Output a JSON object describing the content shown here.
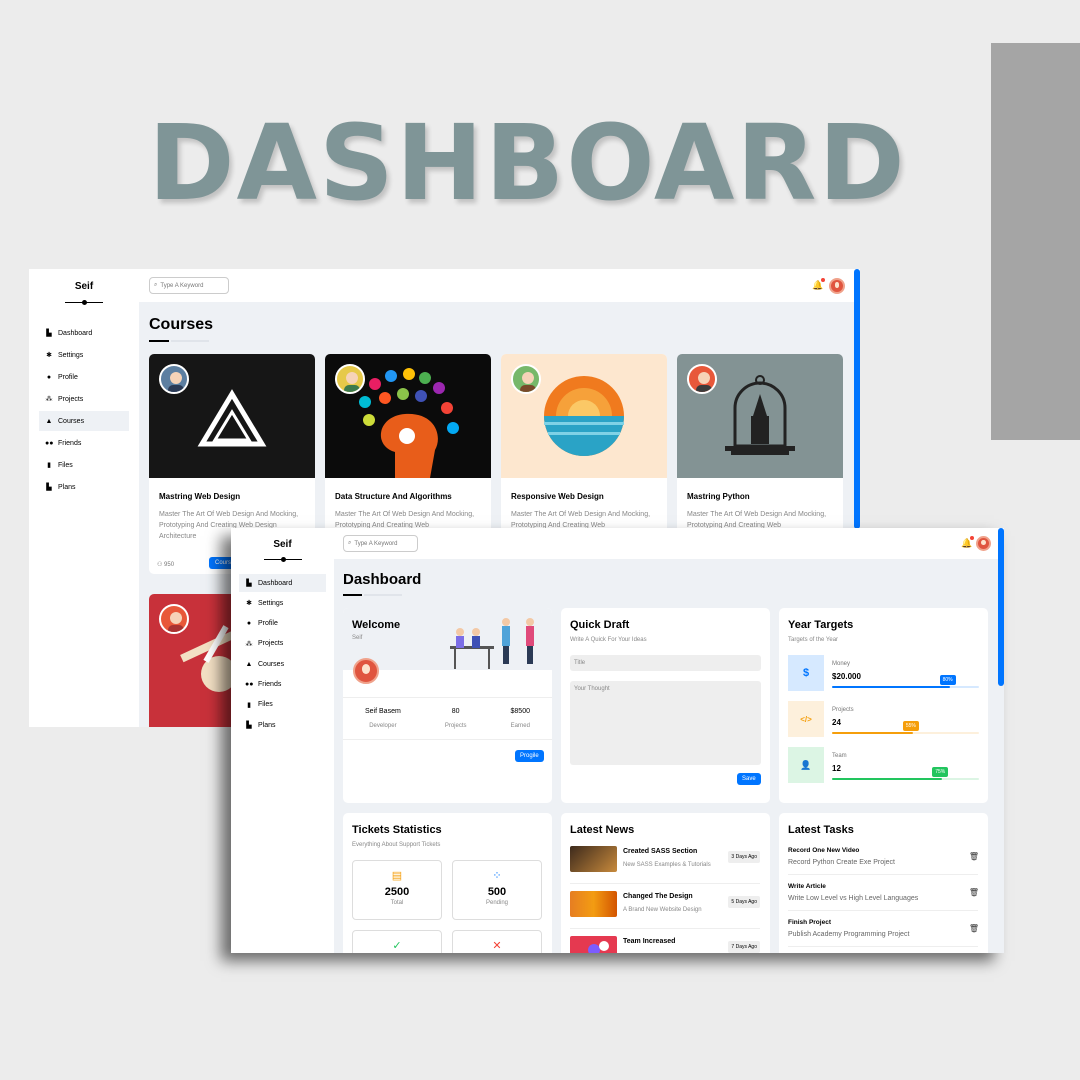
{
  "hero_title": "DASHBOARD",
  "back_window": {
    "brand": "Seif",
    "nav": [
      {
        "label": "Dashboard",
        "icon": "chart-icon"
      },
      {
        "label": "Settings",
        "icon": "gear-icon"
      },
      {
        "label": "Profile",
        "icon": "user-icon"
      },
      {
        "label": "Projects",
        "icon": "diagram-icon"
      },
      {
        "label": "Courses",
        "icon": "graduation-cap-icon"
      },
      {
        "label": "Friends",
        "icon": "users-icon"
      },
      {
        "label": "Files",
        "icon": "file-icon"
      },
      {
        "label": "Plans",
        "icon": "chart-icon"
      }
    ],
    "search_placeholder": "Type A Keyword",
    "page_title": "Courses",
    "courses": [
      {
        "title": "Mastring Web Design",
        "desc": "Master The Art Of Web Design And Mocking, Prototyping And Creating Web Design Architecture",
        "students": "950",
        "button": "Course Info"
      },
      {
        "title": "Data Structure And Algorithms",
        "desc": "Master The Art Of Web Design And Mocking, Prototyping And Creating Web"
      },
      {
        "title": "Responsive Web Design",
        "desc": "Master The Art Of Web Design And Mocking, Prototyping And Creating Web"
      },
      {
        "title": "Mastring Python",
        "desc": "Master The Art Of Web Design And Mocking, Prototyping And Creating Web"
      }
    ]
  },
  "front_window": {
    "brand": "Seif",
    "nav": [
      {
        "label": "Dashboard",
        "icon": "chart-icon"
      },
      {
        "label": "Settings",
        "icon": "gear-icon"
      },
      {
        "label": "Profile",
        "icon": "user-icon"
      },
      {
        "label": "Projects",
        "icon": "diagram-icon"
      },
      {
        "label": "Courses",
        "icon": "graduation-cap-icon"
      },
      {
        "label": "Friends",
        "icon": "users-icon"
      },
      {
        "label": "Files",
        "icon": "file-icon"
      },
      {
        "label": "Plans",
        "icon": "chart-icon"
      }
    ],
    "search_placeholder": "Type A Keyword",
    "page_title": "Dashboard",
    "welcome": {
      "title": "Welcome",
      "subtitle": "Seif",
      "stats": [
        {
          "value": "Seif Basem",
          "label": "Developer"
        },
        {
          "value": "80",
          "label": "Projects"
        },
        {
          "value": "$8500",
          "label": "Earned"
        }
      ],
      "button": "Progile"
    },
    "quick_draft": {
      "title": "Quick Draft",
      "subtitle": "Write A Quick For Your Ideas",
      "title_placeholder": "Title",
      "body_placeholder": "Your Thought",
      "button": "Save"
    },
    "year_targets": {
      "title": "Year Targets",
      "subtitle": "Targets of the Year",
      "items": [
        {
          "label": "Money",
          "value": "$20.000",
          "percent_label": "80%",
          "progress": 0.8,
          "color": "#0075ff",
          "bg": "#d6e9ff",
          "icon": "$"
        },
        {
          "label": "Projects",
          "value": "24",
          "percent_label": "55%",
          "progress": 0.55,
          "color": "#f59e0b",
          "bg": "#fdf0dc",
          "icon": "</>"
        },
        {
          "label": "Team",
          "value": "12",
          "percent_label": "75%",
          "progress": 0.75,
          "color": "#22c55e",
          "bg": "#dcf5e4",
          "icon": "👤"
        }
      ]
    },
    "tickets": {
      "title": "Tickets Statistics",
      "subtitle": "Everything About Support Tickets",
      "items": [
        {
          "value": "2500",
          "label": "Total",
          "icon": "▤",
          "color": "#f59e0b"
        },
        {
          "value": "500",
          "label": "Pending",
          "icon": "⁘",
          "color": "#0075ff"
        },
        {
          "value": "",
          "label": "",
          "icon": "✓",
          "color": "#22c55e"
        },
        {
          "value": "",
          "label": "",
          "icon": "✕",
          "color": "#f44336"
        }
      ]
    },
    "news": {
      "title": "Latest News",
      "items": [
        {
          "title": "Created SASS Section",
          "desc": "New SASS Examples & Tutorials",
          "ago": "3 Days Ago"
        },
        {
          "title": "Changed The Design",
          "desc": "A Brand New Website Design",
          "ago": "5 Days Ago"
        },
        {
          "title": "Team Increased",
          "desc": "",
          "ago": "7 Days Ago"
        }
      ]
    },
    "tasks": {
      "title": "Latest Tasks",
      "items": [
        {
          "title": "Record One New Video",
          "desc": "Record Python Create Exe Project"
        },
        {
          "title": "Write Article",
          "desc": "Write Low Level vs High Level Languages"
        },
        {
          "title": "Finish Project",
          "desc": "Publish Academy Programming Project"
        }
      ]
    }
  }
}
